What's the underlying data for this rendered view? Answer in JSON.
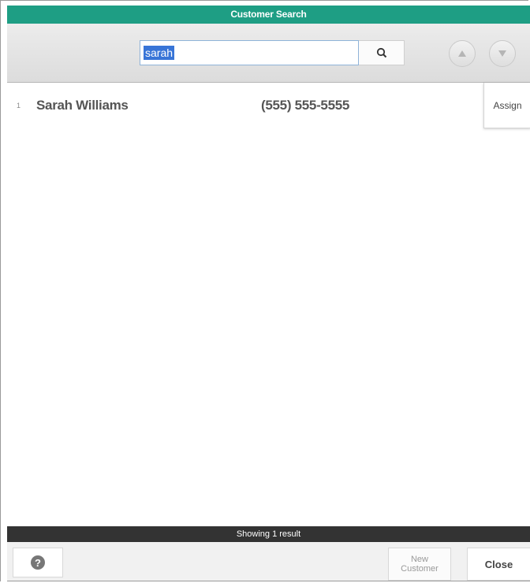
{
  "window": {
    "title": "Customer Search"
  },
  "search": {
    "value": "sarah",
    "button_icon": "search-icon",
    "nav_up_icon": "triangle-up-icon",
    "nav_down_icon": "triangle-down-icon"
  },
  "results": [
    {
      "index": "1",
      "name": "Sarah Williams",
      "phone": "(555) 555-5555",
      "action_label": "Assign"
    }
  ],
  "status": {
    "text": "Showing 1 result"
  },
  "footer": {
    "help_icon": "question-circle-icon",
    "help_glyph": "?",
    "new_customer_line1": "New",
    "new_customer_line2": "Customer",
    "close_label": "Close"
  },
  "colors": {
    "title_bar": "#1e9e84",
    "status_bar": "#333333",
    "selection": "#3875d7"
  }
}
